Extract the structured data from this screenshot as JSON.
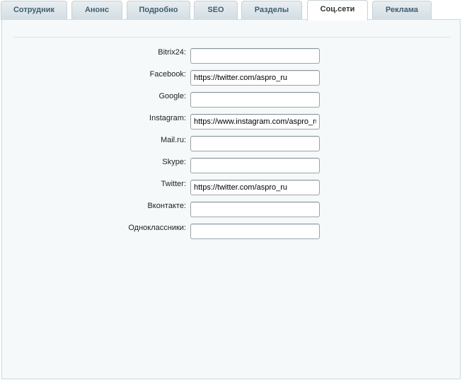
{
  "tabs": [
    {
      "label": "Сотрудник"
    },
    {
      "label": "Анонс"
    },
    {
      "label": "Подробно"
    },
    {
      "label": "SEO"
    },
    {
      "label": "Разделы"
    },
    {
      "label": "Соц.сети",
      "active": true
    },
    {
      "label": "Реклама"
    }
  ],
  "form": {
    "fields": [
      {
        "label": "Bitrix24:",
        "value": ""
      },
      {
        "label": "Facebook:",
        "value": "https://twitter.com/aspro_ru"
      },
      {
        "label": "Google:",
        "value": ""
      },
      {
        "label": "Instagram:",
        "value": "https://www.instagram.com/aspro_ru/"
      },
      {
        "label": "Mail.ru:",
        "value": ""
      },
      {
        "label": "Skype:",
        "value": ""
      },
      {
        "label": "Twitter:",
        "value": "https://twitter.com/aspro_ru"
      },
      {
        "label": "Вконтакте:",
        "value": ""
      },
      {
        "label": "Одноклассники:",
        "value": ""
      }
    ]
  }
}
